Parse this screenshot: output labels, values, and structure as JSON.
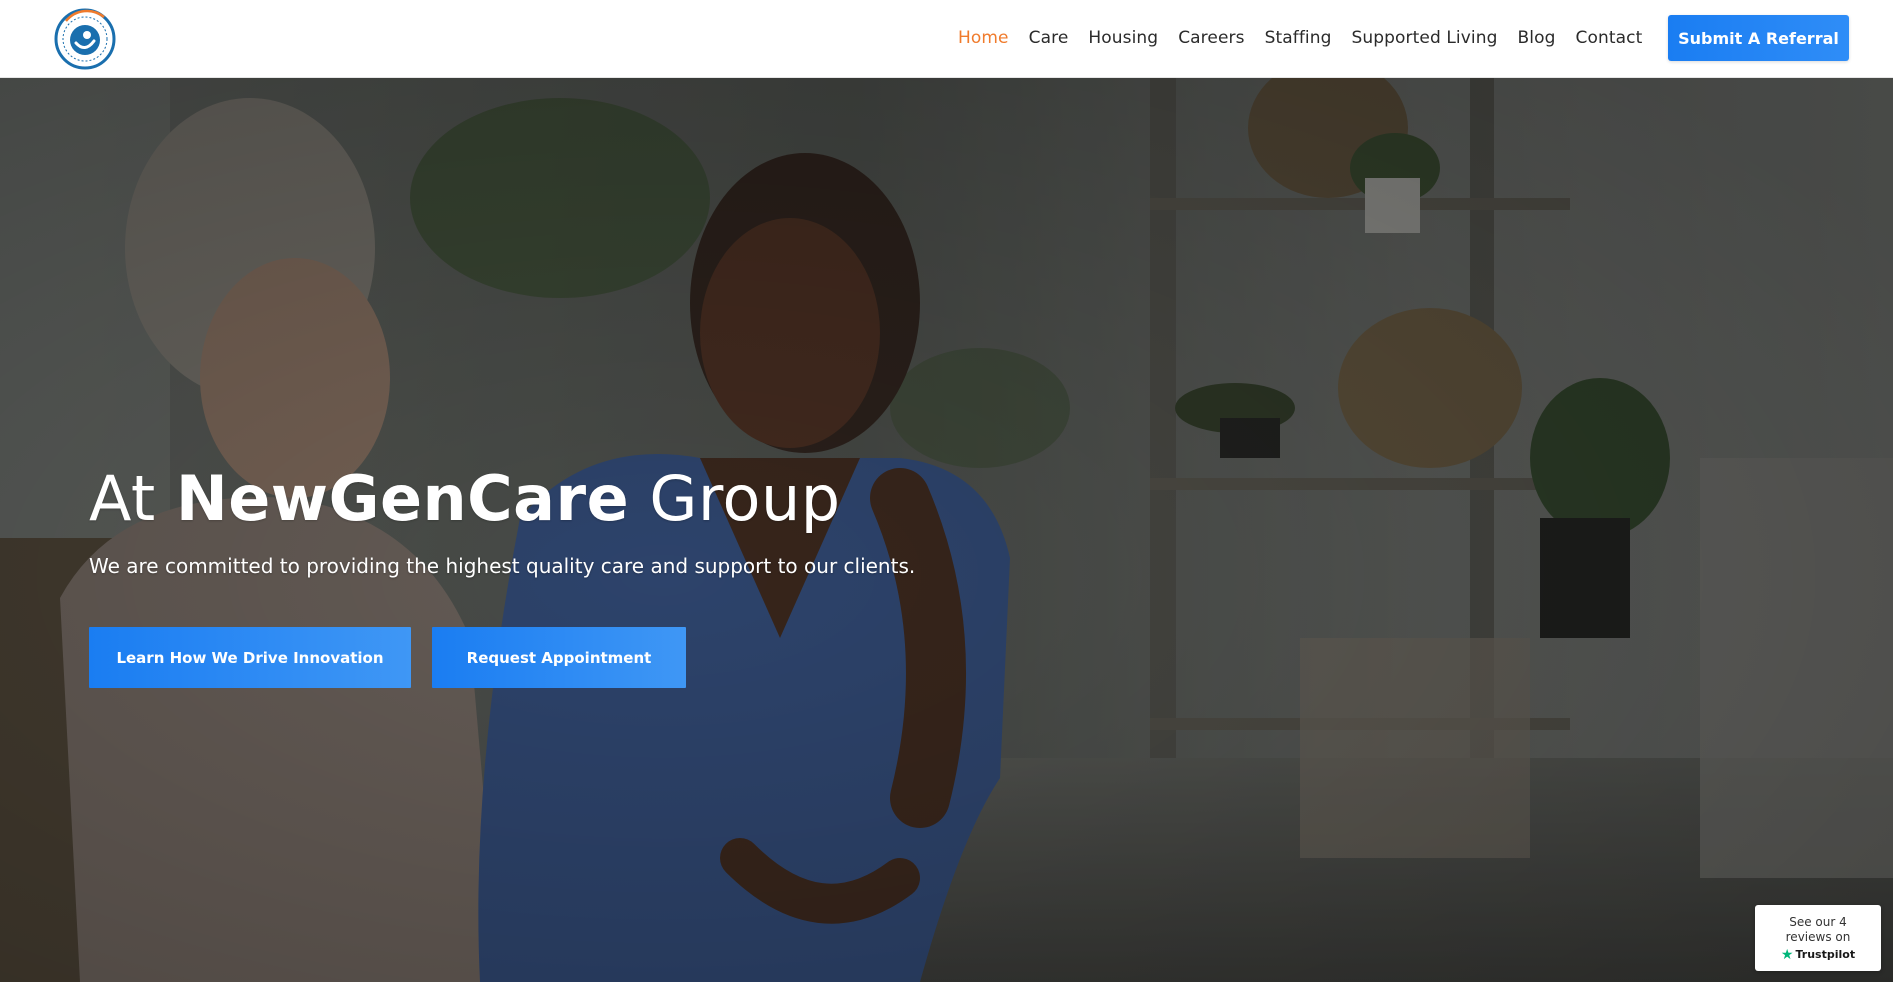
{
  "header": {
    "logo": {
      "text": "NewGenCare Group",
      "colors": {
        "ring": "#1a6fae",
        "accent": "#f07b2c"
      }
    },
    "nav": [
      {
        "label": "Home",
        "active": true
      },
      {
        "label": "Care",
        "active": false
      },
      {
        "label": "Housing",
        "active": false
      },
      {
        "label": "Careers",
        "active": false
      },
      {
        "label": "Staffing",
        "active": false
      },
      {
        "label": "Supported Living",
        "active": false
      },
      {
        "label": "Blog",
        "active": false
      },
      {
        "label": "Contact",
        "active": false
      }
    ],
    "cta_label": "Submit A Referral"
  },
  "hero": {
    "title_prefix": "At",
    "title_brand": "NewGenCare",
    "title_suffix": "Group",
    "subtitle": "We are committed to providing the highest quality care and support to our clients.",
    "buttons": [
      {
        "label": "Learn How We Drive Innovation"
      },
      {
        "label": "Request Appointment"
      }
    ]
  },
  "trustpilot": {
    "line1": "See our 4",
    "line2": "reviews on",
    "brand": "Trustpilot",
    "star_color": "#00b67a"
  },
  "colors": {
    "active_nav": "#f07b2c",
    "button_blue": "#1a7df2",
    "text_dark": "#2b2b2b"
  }
}
